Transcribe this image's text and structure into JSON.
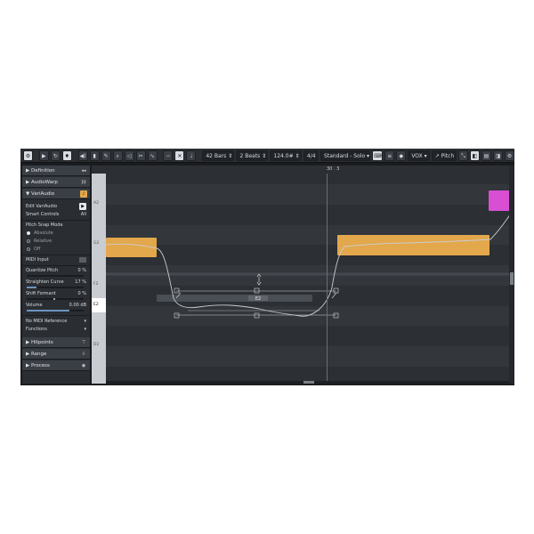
{
  "toolbar": {
    "bars": "42 Bars",
    "beats": "2 Beats",
    "tempo": "124.0#",
    "signature": "4/4",
    "mode": "Standard - Solo",
    "track": "VOX",
    "pitch_btn": "Pitch"
  },
  "inspector": {
    "definition": "Definition",
    "audiowarp": "AudioWarp",
    "variaudio": "VariAudio",
    "edit_variaudio": "Edit VariAudio",
    "smart_controls": "Smart Controls",
    "smart_value": "All",
    "pitch_snap_mode": "Pitch Snap Mode",
    "snap_options": [
      "Absolute",
      "Relative",
      "Off"
    ],
    "midi_input": "MIDI Input",
    "quantize_pitch": "Quantize Pitch",
    "quantize_value": "0 %",
    "quantize_level": 0,
    "straighten_curve": "Straighten Curve",
    "straighten_value": "17 %",
    "straighten_level": 0.17,
    "shift_formant": "Shift Formant",
    "shift_value": "0 %",
    "shift_level": 0.5,
    "volume": "Volume",
    "volume_value": "0.00 dB",
    "volume_level": 0.75,
    "no_midi_reference": "No MIDI Reference",
    "functions": "Functions",
    "hitpoints": "Hitpoints",
    "range": "Range",
    "process": "Process"
  },
  "ruler": {
    "position_label": "30 . 3"
  },
  "piano": {
    "keys": [
      "A2",
      "G2",
      "F2",
      "E2",
      "D2"
    ],
    "highlighted": "E2"
  },
  "segments": [
    {
      "id": "seg-1",
      "note": "G2",
      "color": "#e3a84b",
      "selected": false
    },
    {
      "id": "seg-2",
      "note": "E2",
      "color": "#4a4e55",
      "selected": true,
      "label": "E2"
    },
    {
      "id": "seg-3",
      "note": "G2",
      "color": "#e3a84b",
      "selected": false
    },
    {
      "id": "seg-4",
      "note": "A2",
      "color": "#d84fd4",
      "selected": false
    }
  ],
  "colors": {
    "accent": "#e3a84b",
    "magenta": "#d84fd4",
    "panel": "#2a2d32",
    "toolbar_bg": "#2b2e33"
  },
  "icons": [
    "settings-icon",
    "play-icon",
    "loop-icon",
    "pointer-tool-icon",
    "speaker-icon",
    "pencil-icon",
    "zoom-icon",
    "mute-icon",
    "scissors-icon",
    "snap-icon",
    "metronome-icon",
    "waveform-icon",
    "gear-icon"
  ]
}
